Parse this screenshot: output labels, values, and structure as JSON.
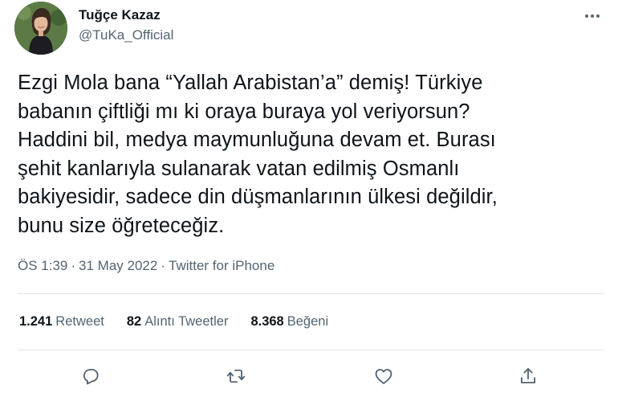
{
  "author": {
    "display_name": "Tuğçe Kazaz",
    "handle": "@TuKa_Official",
    "avatar_icon": "profile-photo"
  },
  "tweet": {
    "text": "Ezgi Mola bana “Yallah Arabistan’a” demiş! Türkiye\nbabanın çiftliği mı ki oraya buraya yol veriyorsun?\nHaddini bil, medya maymunluğuna devam et. Burası\nşehit kanlarıyla sulanarak vatan edilmiş Osmanlı\nbakiyesidir, sadece din düşmanlarının ülkesi değildir,\nbunu size öğreteceğiz."
  },
  "meta": {
    "time": "ÖS 1:39",
    "date": "31 May 2022",
    "source": "Twitter for iPhone",
    "separator": "·"
  },
  "stats": {
    "retweets": {
      "count": "1.241",
      "label": "Retweet"
    },
    "quotes": {
      "count": "82",
      "label": "Alıntı Tweetler"
    },
    "likes": {
      "count": "8.368",
      "label": "Beğeni"
    }
  },
  "actions": [
    "reply-icon",
    "retweet-icon",
    "like-icon",
    "share-icon"
  ],
  "colors": {
    "text": "#0f1419",
    "secondary": "#536471",
    "divider": "#e1e6ea"
  }
}
